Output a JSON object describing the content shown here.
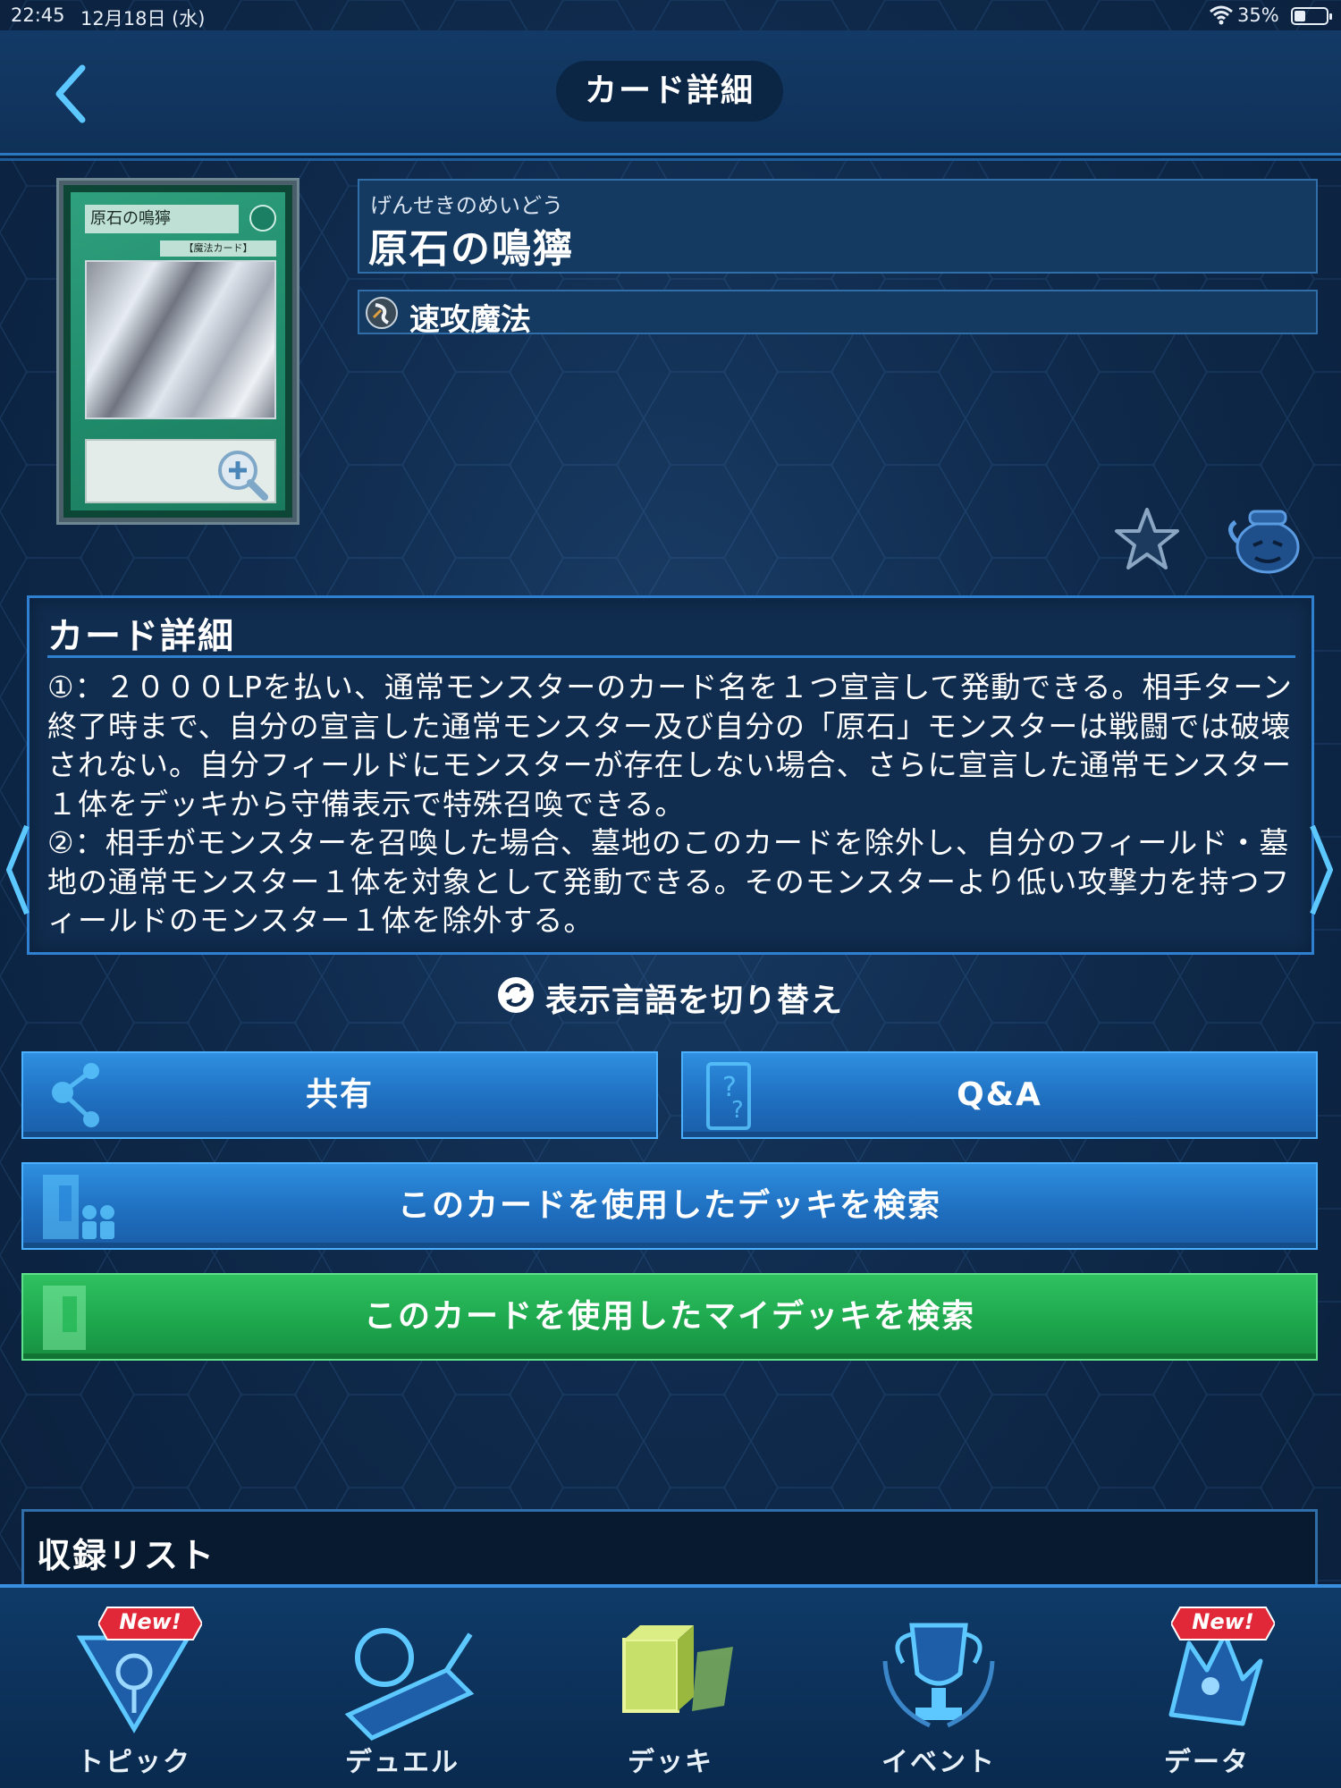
{
  "status_bar": {
    "time": "22:45",
    "date": "12月18日 (水)",
    "battery": "35%"
  },
  "header": {
    "title": "カード詳細"
  },
  "card": {
    "ruby": "げんせきのめいどう",
    "name": "原石の鳴獰",
    "spell_type": "速攻魔法",
    "image_name": "原石の鳴獰",
    "image_type_line": "【魔法カード】"
  },
  "description": {
    "title": "カード詳細",
    "text": "①：２０００LPを払い、通常モンスターのカード名を１つ宣言して発動できる。相手ターン終了時まで、自分の宣言した通常モンスター及び自分の「原石」モンスターは戦闘では破壊されない。自分フィールドにモンスターが存在しない場合、さらに宣言した通常モンスター１体をデッキから守備表示で特殊召喚できる。\n②：相手がモンスターを召喚した場合、墓地のこのカードを除外し、自分のフィールド・墓地の通常モンスター１体を対象として発動できる。そのモンスターより低い攻撃力を持つフィールドのモンスター１体を除外する。"
  },
  "lang_toggle": "表示言語を切り替え",
  "buttons": {
    "share": "共有",
    "qa": "Q&A",
    "deck_search": "このカードを使用したデッキを検索",
    "mydeck_search": "このカードを使用したマイデッキを検索"
  },
  "collection": {
    "title": "収録リスト"
  },
  "bottom_nav": {
    "items": [
      {
        "label": "トピック",
        "badge": "New!"
      },
      {
        "label": "デュエル"
      },
      {
        "label": "デッキ"
      },
      {
        "label": "イベント"
      },
      {
        "label": "データ",
        "badge": "New!"
      }
    ]
  },
  "colors": {
    "background": "#0f2a4c",
    "accent_blue": "#2f8fe0",
    "accent_green": "#2fc060",
    "badge_red": "#e02838"
  },
  "icons": {
    "back": "chevron-left-icon",
    "zoom": "magnify-plus-icon",
    "spell": "quick-play-spell-icon",
    "favorite": "star-icon",
    "rarity": "pot-icon",
    "lang": "swap-icon",
    "share": "share-icon",
    "qa": "qa-icon",
    "deck_search": "deck-people-icon",
    "mydeck_search": "deck-icon"
  }
}
